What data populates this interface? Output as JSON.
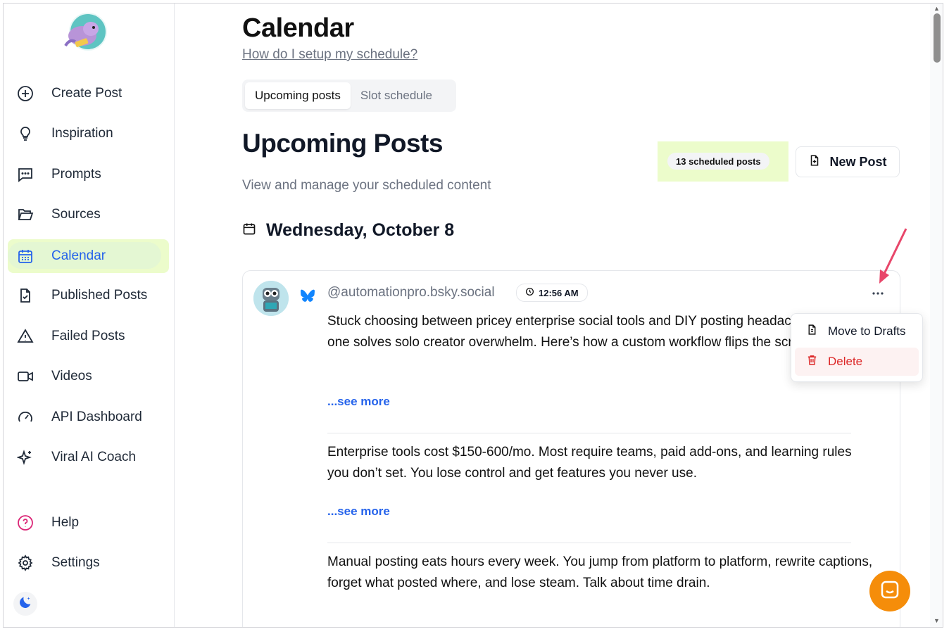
{
  "sidebar": {
    "items": [
      {
        "label": "Create Post",
        "icon": "plus-circle-icon"
      },
      {
        "label": "Inspiration",
        "icon": "lightbulb-icon"
      },
      {
        "label": "Prompts",
        "icon": "message-square-icon"
      },
      {
        "label": "Sources",
        "icon": "folder-open-icon"
      },
      {
        "label": "Calendar",
        "icon": "calendar-icon",
        "active": true
      },
      {
        "label": "Published Posts",
        "icon": "file-check-icon"
      },
      {
        "label": "Failed Posts",
        "icon": "alert-triangle-icon"
      },
      {
        "label": "Videos",
        "icon": "video-icon"
      },
      {
        "label": "API Dashboard",
        "icon": "gauge-icon"
      },
      {
        "label": "Viral AI Coach",
        "icon": "sparkles-icon"
      }
    ],
    "bottom": [
      {
        "label": "Help",
        "icon": "help-circle-icon"
      },
      {
        "label": "Settings",
        "icon": "gear-icon"
      }
    ]
  },
  "header": {
    "title": "Calendar",
    "help_link": "How do I setup my schedule?"
  },
  "tabs": [
    {
      "label": "Upcoming posts",
      "active": true
    },
    {
      "label": "Slot schedule",
      "active": false
    }
  ],
  "section": {
    "title": "Upcoming Posts",
    "subtitle": "View and manage your scheduled content",
    "count_badge": "13 scheduled posts",
    "new_post_label": "New Post"
  },
  "date_heading": "Wednesday, October 8",
  "post": {
    "handle": "@automationpro.bsky.social",
    "time": "12:56 AM",
    "paragraphs": [
      {
        "text": "Stuck choosing between pricey enterprise social tools and DIY posting headaches? Neither one solves solo creator overwhelm. Here’s how a custom workflow flips the script 👇",
        "see_more": "...see more"
      },
      {
        "text": "Enterprise tools cost $150-600/mo. Most require teams, paid add-ons, and learning rules you don’t set. You lose control and get features you never use.",
        "see_more": "...see more"
      },
      {
        "text": "Manual posting eats hours every week. You jump from platform to platform, rewrite captions, forget what posted where, and lose steam. Talk about time drain."
      }
    ]
  },
  "context_menu": {
    "move_to_drafts": "Move to Drafts",
    "delete": "Delete"
  },
  "colors": {
    "accent": "#2563eb",
    "active_bg": "#ecfccb",
    "danger": "#dc2626",
    "fab": "#f58d0a",
    "arrow": "#e8466a"
  }
}
